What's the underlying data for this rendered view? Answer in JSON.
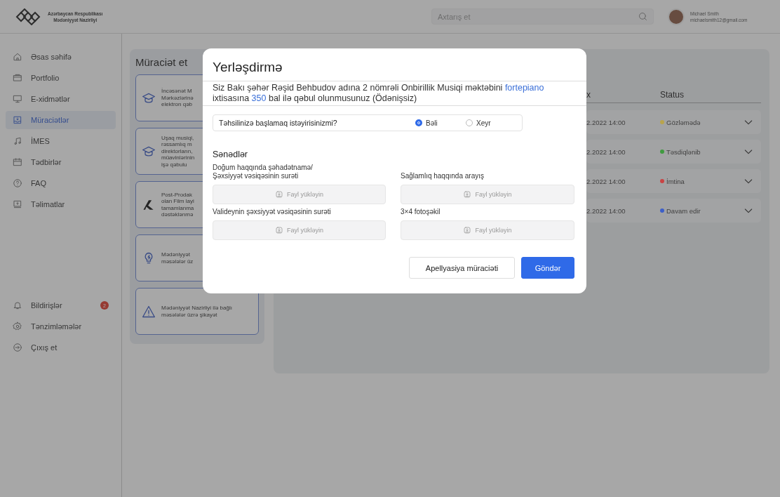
{
  "header": {
    "logo_text": [
      "Azərbaycan Respublikası",
      "Mədəniyyət Nazirliyi"
    ],
    "search": {
      "placeholder": "Axtarış et"
    },
    "user": {
      "name": "Michael Smith",
      "email": "michaelsmith12@gmail.com"
    }
  },
  "sidebar": {
    "items": [
      {
        "label": "Əsas səhifə",
        "selected": false
      },
      {
        "label": "Portfolio",
        "selected": false
      },
      {
        "label": "E-xidmətlər",
        "selected": false
      },
      {
        "label": "Müraciətlər",
        "selected": true
      },
      {
        "label": "İMES",
        "selected": false
      },
      {
        "label": "Tədbirlər",
        "selected": false
      },
      {
        "label": "FAQ",
        "selected": false
      },
      {
        "label": "Təlimatlar",
        "selected": false
      }
    ],
    "bottom_items": [
      {
        "label": "Bildirişlər",
        "badge": "2"
      },
      {
        "label": "Tənzimləmələr"
      },
      {
        "label": "Çıxış et"
      }
    ]
  },
  "apply_panel": {
    "title": "Müraciət et",
    "cards": [
      {
        "lines": [
          "İncəsənət M",
          "Mərkəzlərinə",
          "elektron qəb"
        ]
      },
      {
        "lines": [
          "Uşaq musiqi,",
          "rəssamlıq m",
          "direktorların,",
          "müavinlərinin",
          "işə qəbulu"
        ]
      },
      {
        "lines": [
          "Post-Prodak",
          "olan Film layi",
          "tamamlanma",
          "dəstəklənmə"
        ]
      },
      {
        "lines": [
          "Mədəniyyət",
          "məsələlər üz"
        ]
      },
      {
        "lines": [
          "Mədəniyyət Nazirliyi ilə bağlı",
          "məsələlər üzrə şikayət"
        ]
      }
    ]
  },
  "table": {
    "columns": [
      "x",
      "Status"
    ],
    "rows": [
      {
        "column_1": "2.2022 14:00",
        "status": "Gözləmədə",
        "color": "#b9a44c"
      },
      {
        "column_1": "2.2022 14:00",
        "status": "Təsdiqlənib",
        "color": "#3f9a3f"
      },
      {
        "column_1": "2.2022 14:00",
        "status": "İmtina",
        "color": "#c94444"
      },
      {
        "column_1": "2.2022 14:00",
        "status": "Davam edir",
        "color": "#3c5fc8"
      }
    ]
  },
  "modal": {
    "title": "Yerləşdirmə",
    "description": [
      {
        "text": "Siz Bakı şəhər Rəşid Behbudov adına 2 nömrəli Onbirillik Musiqi məktəbini ",
        "kind": "plain"
      },
      {
        "text": "fortepiano",
        "kind": "highlight"
      },
      {
        "text": " ixtisasına ",
        "kind": "plain"
      },
      {
        "text": "350",
        "kind": "highlight"
      },
      {
        "text": " bal ilə qəbul olunmusunuz  (Ödənişsiz)",
        "kind": "plain"
      }
    ],
    "question": {
      "label": "Təhsilinizə başlamaq istəyirisinizmi?",
      "options": [
        {
          "label": "Bəli",
          "selected": true
        },
        {
          "label": "Xeyr",
          "selected": false
        }
      ]
    },
    "documents_title": "Sənədlər",
    "documents": [
      {
        "label": "Doğum haqqında şəhadətnamə/\nŞəxsiyyət vəsiqəsinin surəti",
        "upload": "Fayl yükləyin"
      },
      {
        "label": "Sağlamlıq haqqında arayış",
        "upload": "Fayl yükləyin"
      },
      {
        "label": "Valideynin şəxsiyyət vəsiqəsinin surəti",
        "upload": "Fayl yükləyin"
      },
      {
        "label": "3×4 fotoşəkil",
        "upload": "Fayl yükləyin"
      }
    ],
    "buttons": [
      {
        "label": "Apellyasiya müraciəti",
        "kind": "secondary"
      },
      {
        "label": "Göndər",
        "kind": "primary"
      }
    ]
  }
}
